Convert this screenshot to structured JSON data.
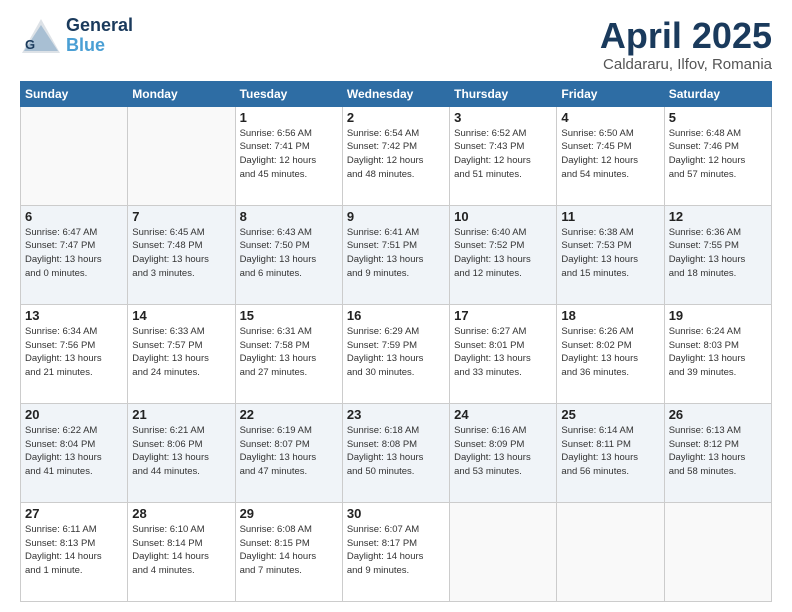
{
  "header": {
    "logo_line1": "General",
    "logo_line2": "Blue",
    "month": "April 2025",
    "location": "Caldararu, Ilfov, Romania"
  },
  "weekdays": [
    "Sunday",
    "Monday",
    "Tuesday",
    "Wednesday",
    "Thursday",
    "Friday",
    "Saturday"
  ],
  "weeks": [
    [
      {
        "day": "",
        "info": ""
      },
      {
        "day": "",
        "info": ""
      },
      {
        "day": "1",
        "info": "Sunrise: 6:56 AM\nSunset: 7:41 PM\nDaylight: 12 hours\nand 45 minutes."
      },
      {
        "day": "2",
        "info": "Sunrise: 6:54 AM\nSunset: 7:42 PM\nDaylight: 12 hours\nand 48 minutes."
      },
      {
        "day": "3",
        "info": "Sunrise: 6:52 AM\nSunset: 7:43 PM\nDaylight: 12 hours\nand 51 minutes."
      },
      {
        "day": "4",
        "info": "Sunrise: 6:50 AM\nSunset: 7:45 PM\nDaylight: 12 hours\nand 54 minutes."
      },
      {
        "day": "5",
        "info": "Sunrise: 6:48 AM\nSunset: 7:46 PM\nDaylight: 12 hours\nand 57 minutes."
      }
    ],
    [
      {
        "day": "6",
        "info": "Sunrise: 6:47 AM\nSunset: 7:47 PM\nDaylight: 13 hours\nand 0 minutes."
      },
      {
        "day": "7",
        "info": "Sunrise: 6:45 AM\nSunset: 7:48 PM\nDaylight: 13 hours\nand 3 minutes."
      },
      {
        "day": "8",
        "info": "Sunrise: 6:43 AM\nSunset: 7:50 PM\nDaylight: 13 hours\nand 6 minutes."
      },
      {
        "day": "9",
        "info": "Sunrise: 6:41 AM\nSunset: 7:51 PM\nDaylight: 13 hours\nand 9 minutes."
      },
      {
        "day": "10",
        "info": "Sunrise: 6:40 AM\nSunset: 7:52 PM\nDaylight: 13 hours\nand 12 minutes."
      },
      {
        "day": "11",
        "info": "Sunrise: 6:38 AM\nSunset: 7:53 PM\nDaylight: 13 hours\nand 15 minutes."
      },
      {
        "day": "12",
        "info": "Sunrise: 6:36 AM\nSunset: 7:55 PM\nDaylight: 13 hours\nand 18 minutes."
      }
    ],
    [
      {
        "day": "13",
        "info": "Sunrise: 6:34 AM\nSunset: 7:56 PM\nDaylight: 13 hours\nand 21 minutes."
      },
      {
        "day": "14",
        "info": "Sunrise: 6:33 AM\nSunset: 7:57 PM\nDaylight: 13 hours\nand 24 minutes."
      },
      {
        "day": "15",
        "info": "Sunrise: 6:31 AM\nSunset: 7:58 PM\nDaylight: 13 hours\nand 27 minutes."
      },
      {
        "day": "16",
        "info": "Sunrise: 6:29 AM\nSunset: 7:59 PM\nDaylight: 13 hours\nand 30 minutes."
      },
      {
        "day": "17",
        "info": "Sunrise: 6:27 AM\nSunset: 8:01 PM\nDaylight: 13 hours\nand 33 minutes."
      },
      {
        "day": "18",
        "info": "Sunrise: 6:26 AM\nSunset: 8:02 PM\nDaylight: 13 hours\nand 36 minutes."
      },
      {
        "day": "19",
        "info": "Sunrise: 6:24 AM\nSunset: 8:03 PM\nDaylight: 13 hours\nand 39 minutes."
      }
    ],
    [
      {
        "day": "20",
        "info": "Sunrise: 6:22 AM\nSunset: 8:04 PM\nDaylight: 13 hours\nand 41 minutes."
      },
      {
        "day": "21",
        "info": "Sunrise: 6:21 AM\nSunset: 8:06 PM\nDaylight: 13 hours\nand 44 minutes."
      },
      {
        "day": "22",
        "info": "Sunrise: 6:19 AM\nSunset: 8:07 PM\nDaylight: 13 hours\nand 47 minutes."
      },
      {
        "day": "23",
        "info": "Sunrise: 6:18 AM\nSunset: 8:08 PM\nDaylight: 13 hours\nand 50 minutes."
      },
      {
        "day": "24",
        "info": "Sunrise: 6:16 AM\nSunset: 8:09 PM\nDaylight: 13 hours\nand 53 minutes."
      },
      {
        "day": "25",
        "info": "Sunrise: 6:14 AM\nSunset: 8:11 PM\nDaylight: 13 hours\nand 56 minutes."
      },
      {
        "day": "26",
        "info": "Sunrise: 6:13 AM\nSunset: 8:12 PM\nDaylight: 13 hours\nand 58 minutes."
      }
    ],
    [
      {
        "day": "27",
        "info": "Sunrise: 6:11 AM\nSunset: 8:13 PM\nDaylight: 14 hours\nand 1 minute."
      },
      {
        "day": "28",
        "info": "Sunrise: 6:10 AM\nSunset: 8:14 PM\nDaylight: 14 hours\nand 4 minutes."
      },
      {
        "day": "29",
        "info": "Sunrise: 6:08 AM\nSunset: 8:15 PM\nDaylight: 14 hours\nand 7 minutes."
      },
      {
        "day": "30",
        "info": "Sunrise: 6:07 AM\nSunset: 8:17 PM\nDaylight: 14 hours\nand 9 minutes."
      },
      {
        "day": "",
        "info": ""
      },
      {
        "day": "",
        "info": ""
      },
      {
        "day": "",
        "info": ""
      }
    ]
  ]
}
